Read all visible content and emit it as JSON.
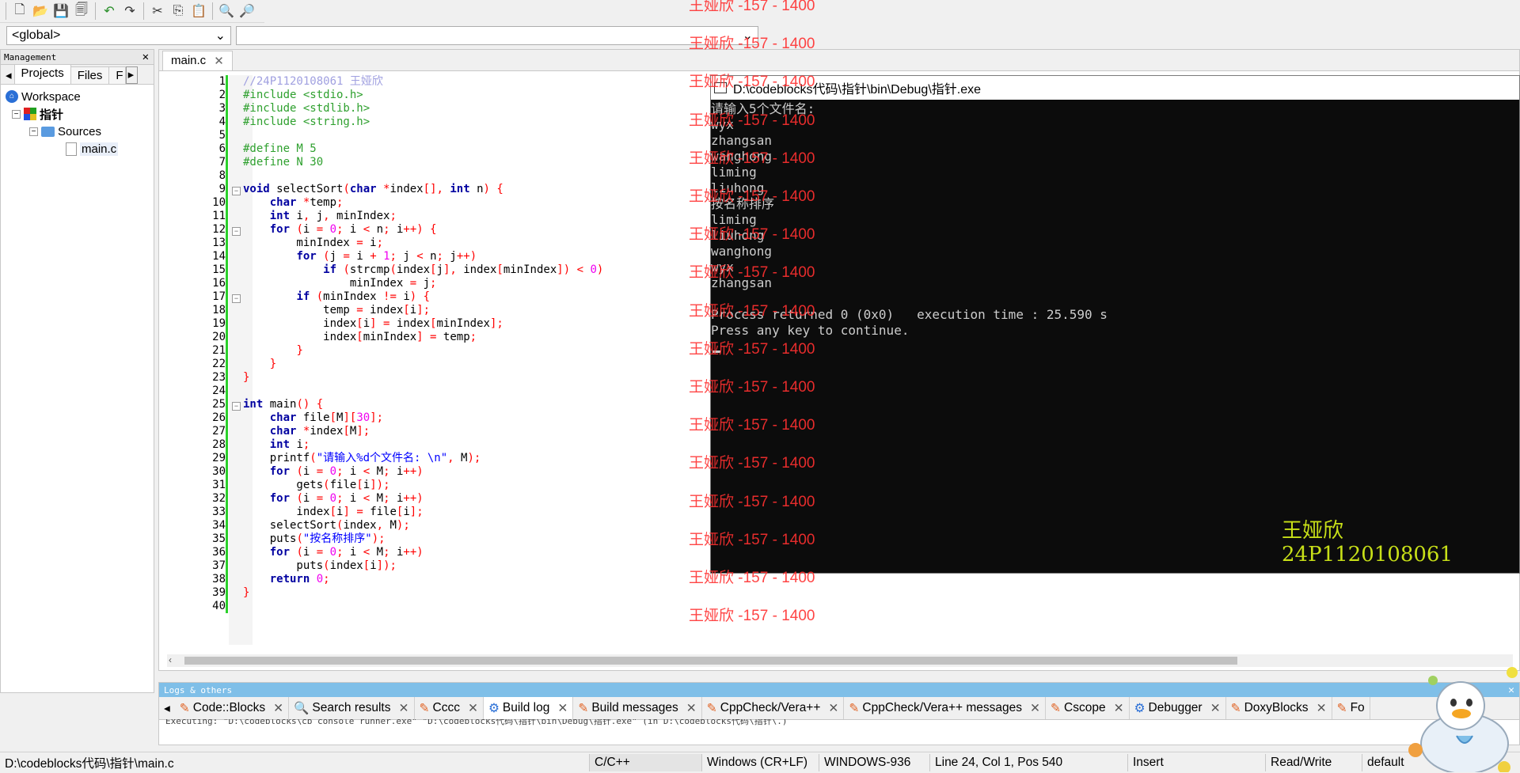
{
  "toolbar": {
    "icons": [
      "new-file-icon",
      "open-file-icon",
      "save-icon",
      "save-all-icon",
      "undo-icon",
      "redo-icon",
      "cut-icon",
      "copy-icon",
      "paste-icon",
      "find-icon",
      "replace-icon"
    ]
  },
  "scope": {
    "value": "<global>",
    "second_value": ""
  },
  "management": {
    "title": "Management",
    "tabs": [
      "Projects",
      "Files",
      "F"
    ],
    "tree": {
      "workspace": "Workspace",
      "project": "指针",
      "folder": "Sources",
      "file": "main.c"
    }
  },
  "editor": {
    "tab_label": "main.c",
    "line_numbers": [
      "1",
      "2",
      "3",
      "4",
      "5",
      "6",
      "7",
      "8",
      "9",
      "10",
      "11",
      "12",
      "13",
      "14",
      "15",
      "16",
      "17",
      "18",
      "19",
      "20",
      "21",
      "22",
      "23",
      "24",
      "25",
      "26",
      "27",
      "28",
      "29",
      "30",
      "31",
      "32",
      "33",
      "34",
      "35",
      "36",
      "37",
      "38",
      "39",
      "40"
    ],
    "code": [
      "//24P1120108061 王娅欣",
      "#include <stdio.h>",
      "#include <stdlib.h>",
      "#include <string.h>",
      "",
      "#define M 5",
      "#define N 30",
      "",
      "void selectSort(char *index[], int n) {",
      "    char *temp;",
      "    int i, j, minIndex;",
      "    for (i = 0; i < n; i++) {",
      "        minIndex = i;",
      "        for (j = i + 1; j < n; j++)",
      "            if (strcmp(index[j], index[minIndex]) < 0)",
      "                minIndex = j;",
      "        if (minIndex != i) {",
      "            temp = index[i];",
      "            index[i] = index[minIndex];",
      "            index[minIndex] = temp;",
      "        }",
      "    }",
      "}",
      "",
      "int main() {",
      "    char file[M][30];",
      "    char *index[M];",
      "    int i;",
      "    printf(\"请输入%d个文件名: \\n\", M);",
      "    for (i = 0; i < M; i++)",
      "        gets(file[i]);",
      "    for (i = 0; i < M; i++)",
      "        index[i] = file[i];",
      "    selectSort(index, M);",
      "    puts(\"按名称排序\");",
      "    for (i = 0; i < M; i++)",
      "        puts(index[i]);",
      "    return 0;",
      "}",
      ""
    ]
  },
  "console": {
    "title": "D:\\codeblocks代码\\指针\\bin\\Debug\\指针.exe",
    "lines": [
      "请输入5个文件名:",
      "wyx",
      "zhangsan",
      "wanghong",
      "liming",
      "liuhong",
      "按名称排序",
      "liming",
      "liuhong",
      "wanghong",
      "wyx",
      "zhangsan",
      "",
      "Process returned 0 (0x0)   execution time : 25.590 s",
      "Press any key to continue."
    ],
    "signature_name": "王娅欣",
    "signature_id": "24P1120108061"
  },
  "logs": {
    "title": "Logs & others",
    "tabs": [
      "Code::Blocks",
      "Search results",
      "Cccc",
      "Build log",
      "Build messages",
      "CppCheck/Vera++",
      "CppCheck/Vera++ messages",
      "Cscope",
      "Debugger",
      "DoxyBlocks",
      "Fo"
    ],
    "active_tab": "Build log",
    "log_line": "Executing: \"D:\\codeblocks\\cb_console_runner.exe\" \"D:\\codeblocks代码\\指针\\bin\\Debug\\指针.exe\"  (in D:\\codeblocks代码\\指针\\.)"
  },
  "status": {
    "path": "D:\\codeblocks代码\\指针\\main.c",
    "language": "C/C++",
    "line_endings": "Windows (CR+LF)",
    "encoding": "WINDOWS-936",
    "position": "Line 24, Col 1, Pos 540",
    "mode": "Insert",
    "access": "Read/Write",
    "profile": "default"
  },
  "watermark": {
    "text": "王娅欣 -157 - 1400",
    "count": 17
  },
  "colors": {
    "keyword": "#0000a0",
    "preprocessor": "#2ea02e",
    "comment": "#a0a0e0",
    "string": "#0000ff",
    "number": "#f000f0",
    "operator": "#ff0000",
    "console_bg": "#0c0c0c",
    "signature": "#c8e018"
  }
}
